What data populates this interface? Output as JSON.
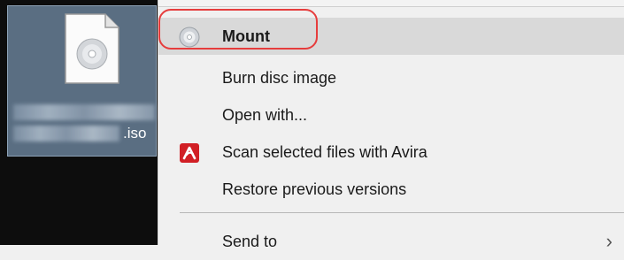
{
  "file": {
    "extension": ".iso"
  },
  "menu": {
    "items": [
      {
        "label": "Mount",
        "icon": "disc-icon"
      },
      {
        "label": "Burn disc image"
      },
      {
        "label": "Open with..."
      },
      {
        "label": "Scan selected files with Avira",
        "icon": "avira-icon"
      },
      {
        "label": "Restore previous versions"
      },
      {
        "label": "Send to"
      }
    ]
  },
  "colors": {
    "highlight_ring": "#e63d3d",
    "avira_red": "#d11f25",
    "menu_background": "#f0f0f0",
    "hover_background": "#d9d9d9"
  }
}
